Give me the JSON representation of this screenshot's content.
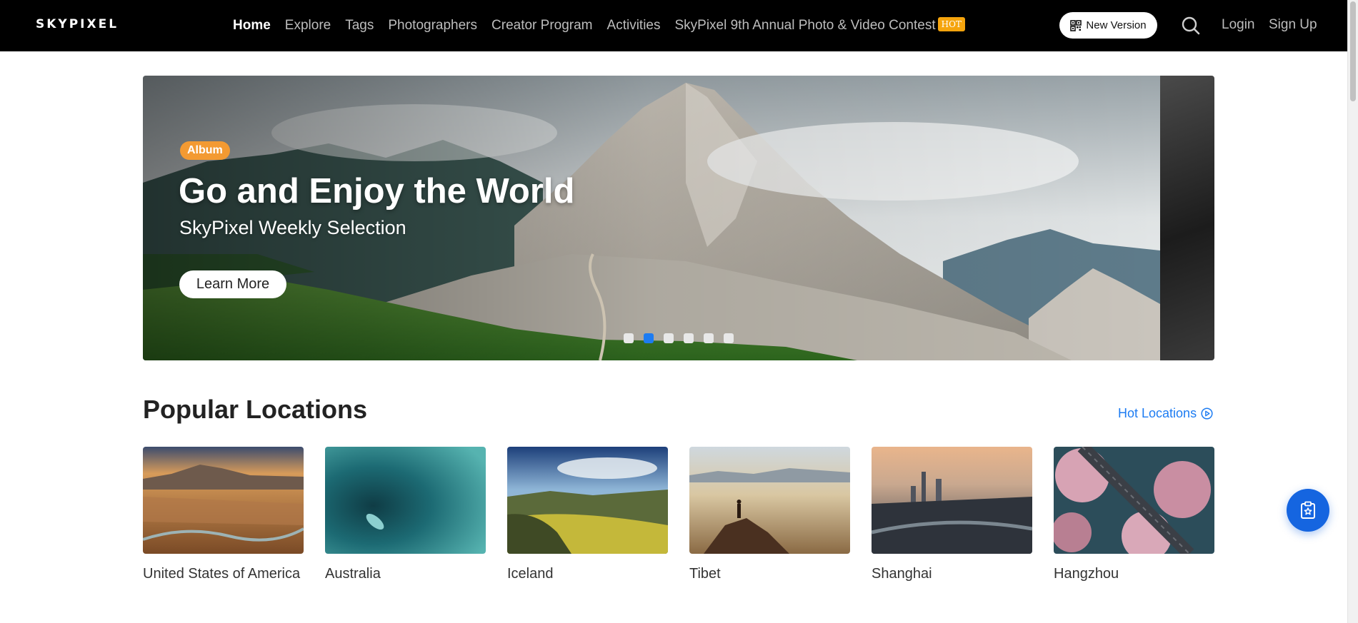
{
  "header": {
    "logo": "SKYPIXEL",
    "nav": [
      {
        "label": "Home",
        "active": true
      },
      {
        "label": "Explore"
      },
      {
        "label": "Tags"
      },
      {
        "label": "Photographers"
      },
      {
        "label": "Creator Program"
      },
      {
        "label": "Activities"
      }
    ],
    "contest_label": "SkyPixel 9th Annual Photo & Video Contest",
    "hot_badge": "HOT",
    "new_version_label": "New Version",
    "login_label": "Login",
    "signup_label": "Sign Up"
  },
  "hero": {
    "tag": "Album",
    "title": "Go and Enjoy the World",
    "subtitle": "SkyPixel Weekly Selection",
    "cta_label": "Learn More",
    "slide_count": 6,
    "active_slide": 2
  },
  "popular": {
    "title": "Popular Locations",
    "link_label": "Hot Locations",
    "locations": [
      {
        "name": "United States of America"
      },
      {
        "name": "Australia"
      },
      {
        "name": "Iceland"
      },
      {
        "name": "Tibet"
      },
      {
        "name": "Shanghai"
      },
      {
        "name": "Hangzhou"
      }
    ]
  },
  "colors": {
    "accent": "#1d7cf2",
    "hot_badge": "#f5a40d",
    "album_tag": "#f39a32",
    "floating_button": "#1565e0"
  },
  "icons": {
    "qr": "qr-code-icon",
    "search": "search-icon",
    "hot_locations": "play-circle-icon",
    "float": "clipboard-star-icon"
  }
}
